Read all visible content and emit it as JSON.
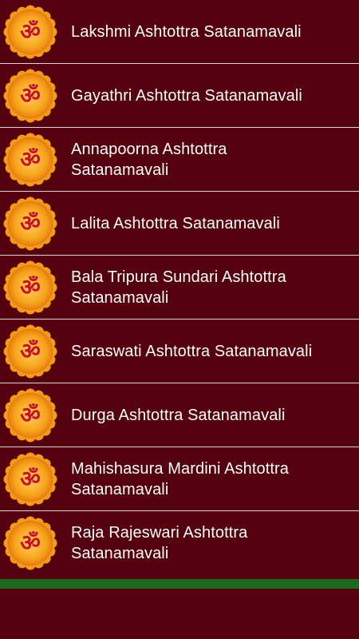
{
  "list": {
    "items": [
      {
        "label": "Lakshmi Ashtottra Satanamavali",
        "icon": "om-icon"
      },
      {
        "label": "Gayathri Ashtottra Satanamavali",
        "icon": "om-icon"
      },
      {
        "label": "Annapoorna Ashtottra Satanamavali",
        "icon": "om-icon"
      },
      {
        "label": "Lalita Ashtottra Satanamavali",
        "icon": "om-icon"
      },
      {
        "label": "Bala Tripura Sundari Ashtottra Satanamavali",
        "icon": "om-icon"
      },
      {
        "label": "Saraswati Ashtottra Satanamavali",
        "icon": "om-icon"
      },
      {
        "label": "Durga Ashtottra Satanamavali",
        "icon": "om-icon"
      },
      {
        "label": "Mahishasura Mardini Ashtottra Satanamavali",
        "icon": "om-icon"
      },
      {
        "label": "Raja Rajeswari Ashtottra Satanamavali",
        "icon": "om-icon"
      }
    ]
  },
  "colors": {
    "background": "#54000f",
    "divider": "#d8d8d8",
    "text": "#ffffff",
    "icon_orange": "#f7a21b",
    "icon_red": "#c8102e",
    "bottom_bar": "#1b6a1e"
  }
}
